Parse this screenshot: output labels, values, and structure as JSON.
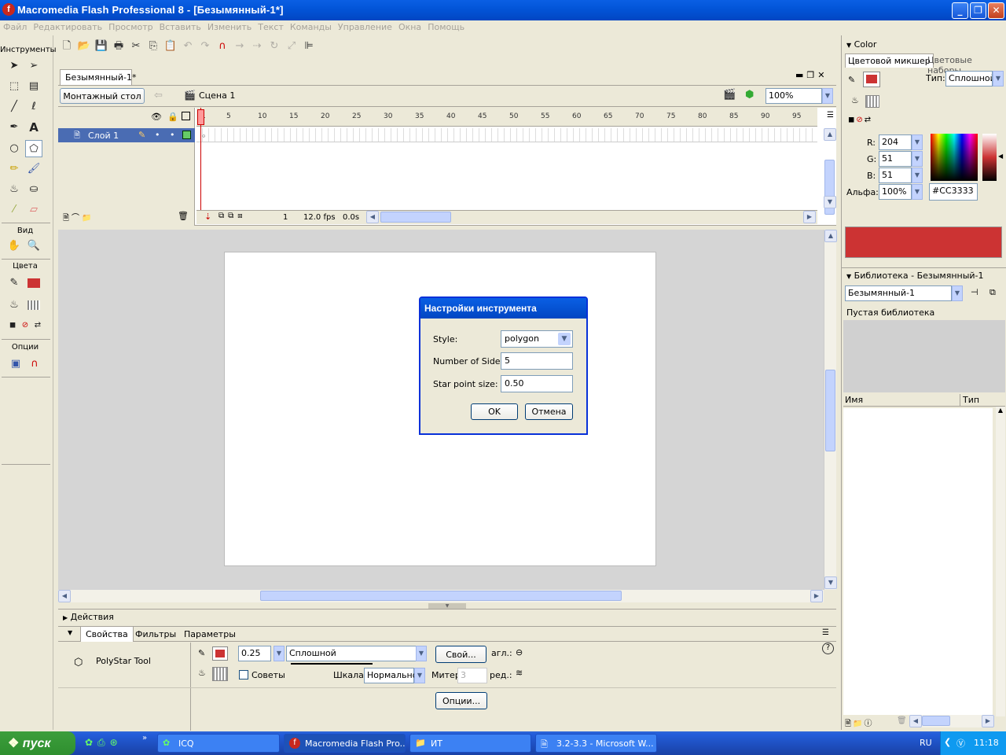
{
  "window": {
    "title": "Macromedia Flash Professional 8 - [Безымянный-1*]"
  },
  "menu": [
    "Файл",
    "Редактировать",
    "Просмотр",
    "Вставить",
    "Изменить",
    "Текст",
    "Команды",
    "Управление",
    "Окна",
    "Помощь"
  ],
  "tools": {
    "title": "Инструменты",
    "view_label": "Вид",
    "colors_label": "Цвета",
    "options_label": "Опции"
  },
  "document": {
    "tab": "Безымянный-1*",
    "stage_button": "Монтажный стол",
    "scene": "Сцена 1",
    "zoom": "100%"
  },
  "timeline": {
    "layer": "Слой 1",
    "ruler": [
      "1",
      "5",
      "10",
      "15",
      "20",
      "25",
      "30",
      "35",
      "40",
      "45",
      "50",
      "55",
      "60",
      "65",
      "70",
      "75",
      "80",
      "85",
      "90",
      "95"
    ],
    "frame": "1",
    "fps": "12.0 fps",
    "time": "0.0s"
  },
  "dialog": {
    "title": "Настройки инструмента",
    "style_label": "Style:",
    "style_value": "polygon",
    "sides_label": "Number of Sides:",
    "sides_value": "5",
    "star_label": "Star point size:",
    "star_value": "0.50",
    "ok": "OK",
    "cancel": "Отмена"
  },
  "actions": {
    "title": "Действия"
  },
  "properties": {
    "tabs": [
      "Свойства",
      "Фильтры",
      "Параметры"
    ],
    "tool_name": "PolyStar Tool",
    "stroke_size": "0.25",
    "stroke_style": "Сплошной",
    "custom_button": "Свой...",
    "angle_label": "агл.:",
    "hints_label": "Советы",
    "scale_label": "Шкала:",
    "scale_value": "Нормально",
    "miter_label": "Митер",
    "miter_value": "3",
    "join_label": "ред.:",
    "options_button": "Опции...",
    "help": "?"
  },
  "color_panel": {
    "title": "Color",
    "tab_mixer": "Цветовой микшер",
    "tab_swatches": "Цветовые наборы",
    "type_label": "Тип:",
    "type_value": "Сплошной",
    "r_label": "R:",
    "r_value": "204",
    "g_label": "G:",
    "g_value": "51",
    "b_label": "B:",
    "b_value": "51",
    "alpha_label": "Альфа:",
    "alpha_value": "100%",
    "hex": "#CC3333",
    "swatch_color": "#cc3333"
  },
  "library": {
    "title": "Библиотека - Безымянный-1",
    "doc_select": "Безымянный-1",
    "empty": "Пустая библиотека",
    "col_name": "Имя",
    "col_type": "Тип"
  },
  "taskbar": {
    "start": "пуск",
    "tasks": [
      "ICQ",
      "Macromedia Flash Pro...",
      "ИТ",
      "3.2-3.3 - Microsoft W..."
    ],
    "lang": "RU",
    "clock": "11:18"
  }
}
